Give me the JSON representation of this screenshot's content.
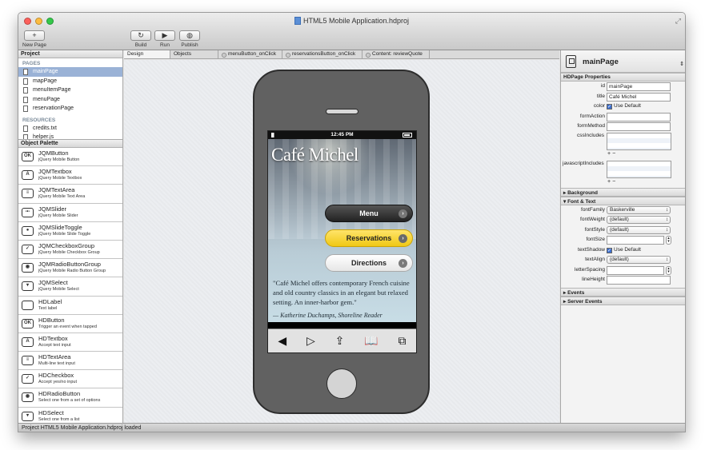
{
  "app": {
    "title": "HTML5 Mobile Application.hdproj",
    "status": "Project HTML5 Mobile Application.hdproj loaded",
    "colors": {
      "close": "#fc605b",
      "min": "#fdbc40",
      "max": "#34c84a",
      "selection": "#9ab2d6"
    }
  },
  "toolbar": {
    "new_page": "New Page",
    "build": "Build",
    "run": "Run",
    "publish": "Publish",
    "new_icon": "+",
    "build_icon": "↻",
    "run_icon": "▶",
    "publish_icon": "◍"
  },
  "project": {
    "header": "Project",
    "pages_label": "PAGES",
    "pages": [
      "mainPage",
      "mapPage",
      "menuItemPage",
      "menuPage",
      "reservationPage"
    ],
    "resources_label": "RESOURCES",
    "resources": [
      "credits.txt",
      "helper.js"
    ]
  },
  "palette": {
    "header": "Object Palette",
    "items": [
      {
        "name": "JQMButton",
        "desc": "jQuery Mobile Button",
        "icon": "OK"
      },
      {
        "name": "JQMTextbox",
        "desc": "jQuery Mobile Textbox",
        "icon": "A"
      },
      {
        "name": "JQMTextArea",
        "desc": "jQuery Mobile Text Area",
        "icon": "≡"
      },
      {
        "name": "JQMSlider",
        "desc": "jQuery Mobile Slider",
        "icon": "-•-"
      },
      {
        "name": "JQMSlideToggle",
        "desc": "jQuery Mobile Slide Toggle",
        "icon": "●"
      },
      {
        "name": "JQMCheckboxGroup",
        "desc": "jQuery Mobile Checkbox Group",
        "icon": "✓"
      },
      {
        "name": "JQMRadioButtonGroup",
        "desc": "jQuery Mobile Radio Button Group",
        "icon": "◉"
      },
      {
        "name": "JQMSelect",
        "desc": "jQuery Mobile Select",
        "icon": "▾"
      },
      {
        "name": "HDLabel",
        "desc": "Text label",
        "icon": ""
      },
      {
        "name": "HDButton",
        "desc": "Trigger an event when tapped",
        "icon": "OK"
      },
      {
        "name": "HDTextbox",
        "desc": "Accept text input",
        "icon": "A"
      },
      {
        "name": "HDTextArea",
        "desc": "Multi-line text input",
        "icon": "≡"
      },
      {
        "name": "HDCheckbox",
        "desc": "Accept yes/no input",
        "icon": "✓"
      },
      {
        "name": "HDRadioButton",
        "desc": "Select one from a set of options",
        "icon": "◉"
      },
      {
        "name": "HDSelect",
        "desc": "Select one from a list",
        "icon": "▾"
      }
    ]
  },
  "tabs": [
    "Design",
    "Objects",
    "menuButton_onClick",
    "reservationsButton_onClick",
    "Content: reviewQuote"
  ],
  "phone": {
    "time": "12:45 PM",
    "cafe_name": "Café Michel",
    "buttons": [
      "Menu",
      "Reservations",
      "Directions"
    ],
    "quote": "\"Café Michel offers contemporary French cuisine and old country classics in an elegant but relaxed setting. An inner-harbor gem.\"",
    "attribution": "— Katherine Duchamps, Shoreline Reader",
    "nav": [
      "◀",
      "▷",
      "⇪",
      "📖",
      "⧉"
    ]
  },
  "inspector": {
    "title": "mainPage",
    "section": "HDPage Properties",
    "id_label": "id",
    "id": "mainPage",
    "title_label": "title",
    "title_value": "Café Michel",
    "color_label": "color",
    "use_default": "Use Default",
    "form_action": "formAction",
    "form_method": "formMethod",
    "css_includes": "cssIncludes",
    "js_includes": "javascriptIncludes",
    "background": "Background",
    "font_text": "Font & Text",
    "font_family": "fontFamily",
    "font_family_val": "Baskerville",
    "font_weight": "fontWeight",
    "font_weight_val": "(default)",
    "font_style": "fontStyle",
    "font_style_val": "(default)",
    "font_size": "fontSize",
    "text_shadow": "textShadow",
    "text_align": "textAlign",
    "text_align_val": "(default)",
    "letter_spacing": "letterSpacing",
    "line_height": "lineHeight",
    "events": "Events",
    "server_events": "Server Events"
  }
}
